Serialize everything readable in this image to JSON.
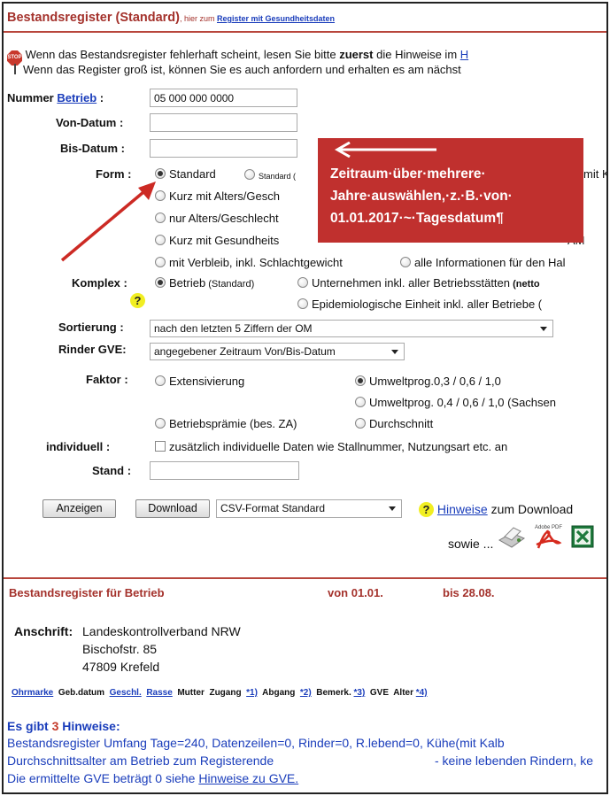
{
  "header": {
    "title": "Bestandsregister (Standard)",
    "subtitle_prefix": ", hier zum ",
    "subtitle_link": "Register mit Gesundheitsdaten"
  },
  "notice": {
    "line1_a": "Wenn das Bestandsregister fehlerhaft scheint, lesen Sie bitte ",
    "line1_bold": "zuerst",
    "line1_b": " die Hinweise im ",
    "line1_link": "H",
    "line2": "Wenn das Register groß ist, können Sie es auch anfordern und erhalten es am nächst"
  },
  "form": {
    "nummer_label": "Nummer ",
    "nummer_link": "Betrieb",
    "nummer_colon": " :",
    "nummer_value": "05 000 000 0000",
    "von_label": "Von-Datum :",
    "von_value": "",
    "bis_label": "Bis-Datum :",
    "bis_value": "",
    "form_label": "Form :",
    "form_options": [
      "Standard",
      "Standard (",
      "mit Ka",
      "Kurz mit Alters/Gesch",
      "nur Alters/Geschlecht",
      "Kurz mit Gesundheits",
      "AM",
      "mit Verbleib, inkl. Schlachtgewicht",
      "alle Informationen für den Hal"
    ],
    "komplex_label": "Komplex :",
    "komplex_opt1": "Betrieb",
    "komplex_opt1_small": " (Standard)",
    "komplex_opt2": "Unternehmen inkl. aller Betriebsstätten",
    "komplex_opt2_small": " (netto",
    "komplex_opt3": "Epidemiologische Einheit inkl. aller Betriebe (",
    "sortierung_label": "Sortierung :",
    "sortierung_value": "nach den letzten 5 Ziffern der OM",
    "rinder_label": "Rinder GVE:",
    "rinder_value": "angegebener Zeitraum Von/Bis-Datum",
    "faktor_label": "Faktor :",
    "faktor_opt1": "Extensivierung",
    "faktor_opt2": "Umweltprog.0,3 / 0,6 / 1,0",
    "faktor_opt3": "Umweltprog. 0,4 / 0,6 / 1,0 (Sachsen",
    "faktor_opt4": "Betriebsprämie (bes. ZA)",
    "faktor_opt5": "Durchschnitt",
    "individuell_label": "individuell :",
    "individuell_text": "zusätzlich individuelle Daten wie Stallnummer, Nutzungsart etc. an",
    "stand_label": "Stand :",
    "stand_value": ""
  },
  "actions": {
    "anzeigen": "Anzeigen",
    "download": "Download",
    "format_value": "CSV-Format Standard",
    "hinweise_link": "Hinweise",
    "hinweise_suffix": " zum Download",
    "sowie": "sowie ..."
  },
  "callout": {
    "line1": "Zeitraum·über·mehrere·",
    "line2": "Jahre·auswählen,·z.·B.·von·",
    "line3": "01.01.2017·~·Tagesdatum¶"
  },
  "result": {
    "title": "Bestandsregister für Betrieb",
    "von": "von 01.01.",
    "bis": "bis 28.08.",
    "anschrift_label": "Anschrift:",
    "anschrift_line1": "Landeskontrollverband NRW",
    "anschrift_line2": "Bischofstr. 85",
    "anschrift_line3": "47809 Krefeld",
    "columns": [
      "Ohrmarke",
      "Geb.datum",
      "Geschl.",
      "Rasse",
      "Mutter",
      "Zugang",
      "*1)",
      "Abgang",
      "*2)",
      "Bemerk.",
      "*3)",
      "GVE",
      "Alter",
      "*4)"
    ],
    "hinweise_title_a": "Es gibt ",
    "hinweise_count": "3",
    "hinweise_title_b": " Hinweise:",
    "hint1": "Bestandsregister Umfang Tage=240, Datenzeilen=0, Rinder=0, R.lebend=0, Kühe(mit Kalb",
    "hint2a": "Durchschnittsalter am Betrieb zum Registerende",
    "hint2b": "- keine lebenden Rindern, ke",
    "hint3a": "Die ermittelte GVE beträgt 0 siehe ",
    "hint3_link": "Hinweise zu GVE."
  }
}
